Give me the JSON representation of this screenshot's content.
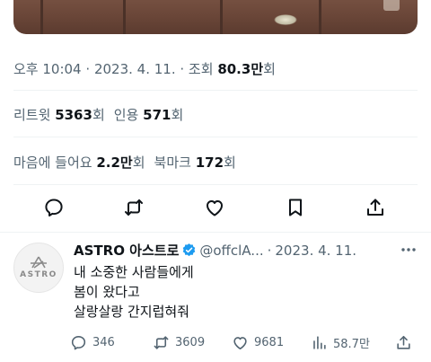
{
  "tweet": {
    "time": "오후 10:04",
    "date": "2023. 4. 11.",
    "views_label": "조회",
    "views_value": "80.3만",
    "views_unit": "회",
    "retweets_label": "리트윗",
    "retweets_value": "5363",
    "retweets_unit": "회",
    "quotes_label": "인용",
    "quotes_value": "571",
    "quotes_unit": "회",
    "likes_label": "마음에 들어요",
    "likes_value": "2.2만",
    "likes_unit": "회",
    "bookmarks_label": "북마크",
    "bookmarks_value": "172",
    "bookmarks_unit": "회"
  },
  "actions": [
    "reply-icon",
    "retweet-icon",
    "heart-icon",
    "bookmark-icon",
    "share-icon"
  ],
  "reply": {
    "avatar_text": "ASTRO",
    "name": "ASTRO 아스트로",
    "handle": "@offclA...",
    "dot": "·",
    "date": "2023. 4. 11.",
    "lines": [
      "내 소중한 사람들에게",
      "봄이 왔다고",
      "살랑살랑 간지럽혀줘"
    ],
    "replies": "346",
    "retweets": "3609",
    "likes": "9681",
    "views": "58.7만"
  },
  "colors": {
    "text": "#0f1419",
    "secondary": "#536471",
    "verified": "#1d9bf0"
  }
}
